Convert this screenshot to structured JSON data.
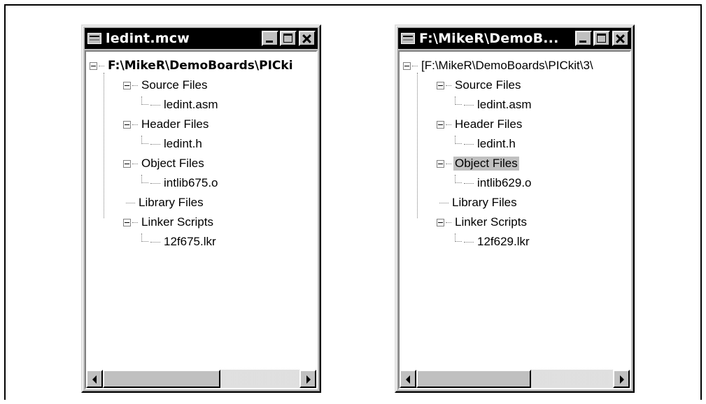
{
  "left_window": {
    "title": "ledint.mcw",
    "root": "F:\\MikeR\\DemoBoards\\PICki",
    "groups": [
      {
        "label": "Source Files",
        "children": [
          "ledint.asm"
        ]
      },
      {
        "label": "Header Files",
        "children": [
          "ledint.h"
        ]
      },
      {
        "label": "Object Files",
        "children": [
          "intlib675.o"
        ]
      },
      {
        "label": "Library Files",
        "children": []
      },
      {
        "label": "Linker Scripts",
        "children": [
          "12f675.lkr"
        ]
      }
    ]
  },
  "right_window": {
    "title": "F:\\MikeR\\DemoB...",
    "root": "[F:\\MikeR\\DemoBoards\\PICkit\\3\\",
    "selected_item": "Object Files",
    "groups": [
      {
        "label": "Source Files",
        "children": [
          "ledint.asm"
        ]
      },
      {
        "label": "Header Files",
        "children": [
          "ledint.h"
        ]
      },
      {
        "label": "Object Files",
        "children": [
          "intlib629.o"
        ]
      },
      {
        "label": "Library Files",
        "children": []
      },
      {
        "label": "Linker Scripts",
        "children": [
          "12f629.lkr"
        ]
      }
    ]
  },
  "icons": {
    "system_menu": "window-menu-icon",
    "minimize": "minimize-icon",
    "maximize": "maximize-icon",
    "close": "close-icon",
    "expander": "collapse-minus-icon",
    "scroll_left": "arrow-left-icon",
    "scroll_right": "arrow-right-icon"
  },
  "colors": {
    "title_bar": "#000000",
    "title_text": "#ffffff",
    "window_face": "#c0c0c0",
    "selection": "#c0c0c0"
  }
}
